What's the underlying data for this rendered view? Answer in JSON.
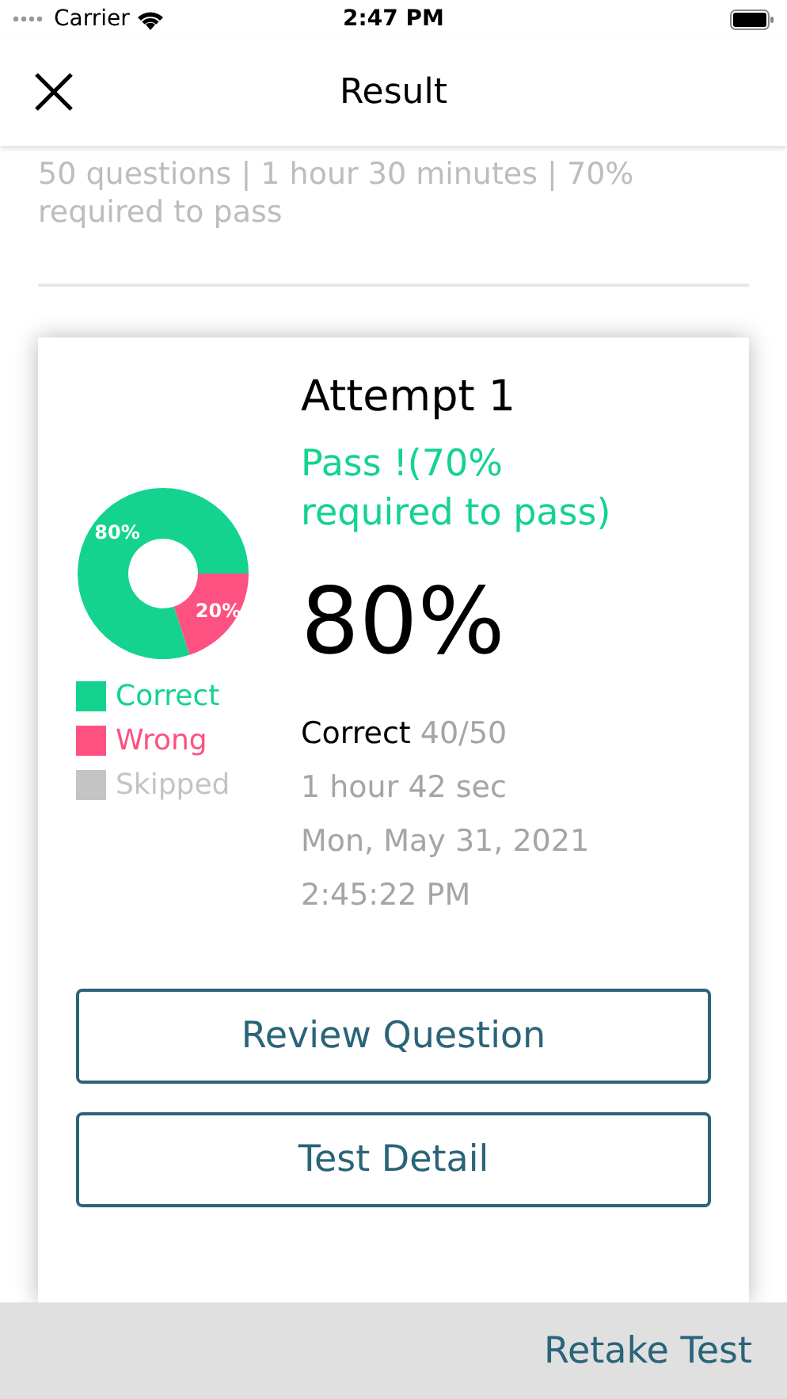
{
  "status_bar": {
    "carrier": "Carrier",
    "time": "2:47 PM"
  },
  "nav_bar": {
    "title": "Result"
  },
  "summary": "50 questions | 1 hour 30 minutes | 70% required to pass",
  "attempt": {
    "title": "Attempt 1",
    "result": "Pass !(70% required to pass)",
    "score": "80%",
    "correct_label": "Correct",
    "correct_value": "40/50",
    "duration": "1 hour 42 sec",
    "date": "Mon, May 31, 2021",
    "time": "2:45:22 PM",
    "chart_data": {
      "type": "donut",
      "categories": [
        "Correct",
        "Wrong",
        "Skipped"
      ],
      "series": [
        {
          "values": [
            80,
            20,
            0
          ]
        }
      ],
      "data_labels": "value_labels",
      "value_labels": [
        "80%",
        "20%",
        null
      ]
    },
    "legend": [
      {
        "color": "#14d38f"
      },
      {
        "color": "#fd5181"
      },
      {
        "color": "#c4c4c4"
      }
    ]
  },
  "buttons": [
    {
      "label": "Review Question"
    },
    {
      "label": "Test Detail"
    }
  ],
  "footer": {
    "action": "Retake Test"
  }
}
